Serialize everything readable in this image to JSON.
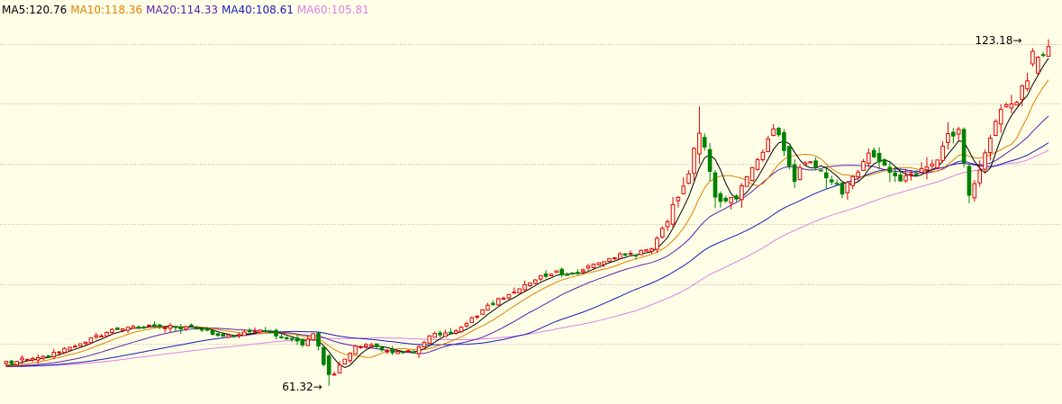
{
  "chart_data": {
    "type": "candlestick",
    "grid": "horizontal-dotted",
    "ylim": [
      58,
      132
    ],
    "gridlines": [
      69,
      80,
      91,
      102,
      113,
      124
    ],
    "legend": [
      {
        "key": "ma5",
        "label": "MA5:120.76",
        "color": "#000000"
      },
      {
        "key": "ma10",
        "label": "MA10:118.36",
        "color": "#E08000"
      },
      {
        "key": "ma20",
        "label": "MA20:114.33",
        "color": "#5A1FA8"
      },
      {
        "key": "ma40",
        "label": "MA40:108.61",
        "color": "#1A1AB8"
      },
      {
        "key": "ma60",
        "label": "MA60:105.81",
        "color": "#E080E0"
      }
    ],
    "annotations": {
      "high_label": "123.18→",
      "low_label": "61.32→",
      "high_value": 123.18,
      "low_value": 61.32,
      "high_index": 194,
      "low_index": 61
    },
    "up_color": "#E00000",
    "down_color": "#008000",
    "anchors": [
      [
        0,
        65.5
      ],
      [
        8,
        67.0
      ],
      [
        15,
        69.5
      ],
      [
        20,
        71.5
      ],
      [
        28,
        72.5
      ],
      [
        34,
        72.0
      ],
      [
        42,
        70.5
      ],
      [
        47,
        71.5
      ],
      [
        52,
        70.5
      ],
      [
        56,
        69.0
      ],
      [
        58,
        71.0
      ],
      [
        60,
        65.5
      ],
      [
        61,
        62.5
      ],
      [
        62,
        63.5
      ],
      [
        64,
        66.5
      ],
      [
        66,
        68.5
      ],
      [
        70,
        68.5
      ],
      [
        74,
        67.5
      ],
      [
        77,
        67.5
      ],
      [
        80,
        70.5
      ],
      [
        84,
        71.0
      ],
      [
        88,
        73.5
      ],
      [
        92,
        76.5
      ],
      [
        96,
        78.5
      ],
      [
        100,
        81.0
      ],
      [
        104,
        82.0
      ],
      [
        108,
        82.0
      ],
      [
        112,
        84.0
      ],
      [
        116,
        85.5
      ],
      [
        119,
        85.5
      ],
      [
        122,
        86.5
      ],
      [
        125,
        92.0
      ],
      [
        128,
        98.0
      ],
      [
        131,
        107.0
      ],
      [
        132,
        105.0
      ],
      [
        134,
        96.0
      ],
      [
        137,
        95.0
      ],
      [
        140,
        99.0
      ],
      [
        143,
        104.0
      ],
      [
        145,
        108.0
      ],
      [
        147,
        105.0
      ],
      [
        149,
        99.5
      ],
      [
        152,
        103.0
      ],
      [
        155,
        100.0
      ],
      [
        158,
        97.0
      ],
      [
        161,
        101.0
      ],
      [
        163,
        104.5
      ],
      [
        166,
        102.0
      ],
      [
        169,
        98.5
      ],
      [
        172,
        100.0
      ],
      [
        175,
        101.5
      ],
      [
        178,
        107.5
      ],
      [
        180,
        107.5
      ],
      [
        182,
        96.0
      ],
      [
        185,
        104.0
      ],
      [
        188,
        112.5
      ],
      [
        191,
        113.5
      ],
      [
        194,
        120.0
      ],
      [
        197,
        123.0
      ]
    ]
  }
}
